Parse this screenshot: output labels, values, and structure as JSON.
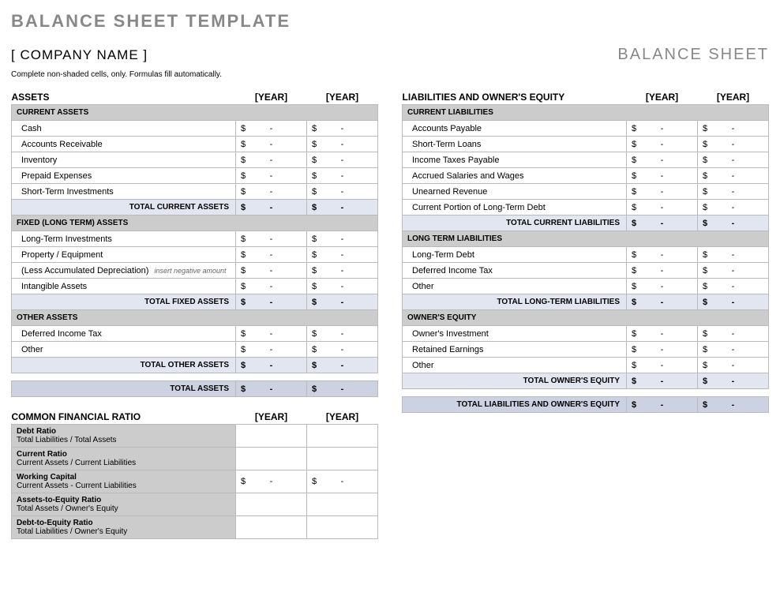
{
  "title": "BALANCE SHEET TEMPLATE",
  "company": "[ COMPANY NAME ]",
  "doc_label": "BALANCE SHEET",
  "instruction": "Complete non-shaded cells, only.  Formulas fill automatically.",
  "year_placeholder": "[YEAR]",
  "currency": "$",
  "dash": "-",
  "assets": {
    "heading": "ASSETS",
    "current": {
      "sub_heading": "CURRENT ASSETS",
      "items": [
        "Cash",
        "Accounts Receivable",
        "Inventory",
        "Prepaid Expenses",
        "Short-Term Investments"
      ],
      "total_label": "TOTAL CURRENT ASSETS"
    },
    "fixed": {
      "sub_heading": "FIXED (LONG TERM) ASSETS",
      "items": [
        "Long-Term Investments",
        "Property / Equipment",
        "(Less Accumulated Depreciation)",
        "Intangible Assets"
      ],
      "hint_index": 2,
      "hint_text": "insert negative amount",
      "total_label": "TOTAL FIXED ASSETS"
    },
    "other": {
      "sub_heading": "OTHER ASSETS",
      "items": [
        "Deferred Income Tax",
        "Other"
      ],
      "total_label": "TOTAL OTHER ASSETS"
    },
    "grand_total": "TOTAL ASSETS"
  },
  "liabilities": {
    "heading": "LIABILITIES AND OWNER'S EQUITY",
    "current": {
      "sub_heading": "CURRENT LIABILITIES",
      "items": [
        "Accounts Payable",
        "Short-Term Loans",
        "Income Taxes Payable",
        "Accrued Salaries and Wages",
        "Unearned Revenue",
        "Current Portion of Long-Term Debt"
      ],
      "total_label": "TOTAL CURRENT LIABILITIES"
    },
    "longterm": {
      "sub_heading": "LONG TERM LIABILITIES",
      "items": [
        "Long-Term Debt",
        "Deferred Income Tax",
        "Other"
      ],
      "total_label": "TOTAL LONG-TERM LIABILITIES"
    },
    "equity": {
      "sub_heading": "OWNER'S EQUITY",
      "items": [
        "Owner's Investment",
        "Retained Earnings",
        "Other"
      ],
      "total_label": "TOTAL OWNER'S EQUITY"
    },
    "grand_total": "TOTAL LIABILITIES AND OWNER'S EQUITY"
  },
  "ratios": {
    "heading": "COMMON FINANCIAL RATIO",
    "items": [
      {
        "name": "Debt Ratio",
        "desc": "Total Liabilities / Total Assets",
        "has_val": false
      },
      {
        "name": "Current Ratio",
        "desc": "Current Assets / Current Liabilities",
        "has_val": false
      },
      {
        "name": "Working Capital",
        "desc": "Current Assets - Current Liabilities",
        "has_val": true
      },
      {
        "name": "Assets-to-Equity Ratio",
        "desc": "Total Assets / Owner's Equity",
        "has_val": false
      },
      {
        "name": "Debt-to-Equity Ratio",
        "desc": "Total Liabilities / Owner's Equity",
        "has_val": false
      }
    ]
  }
}
